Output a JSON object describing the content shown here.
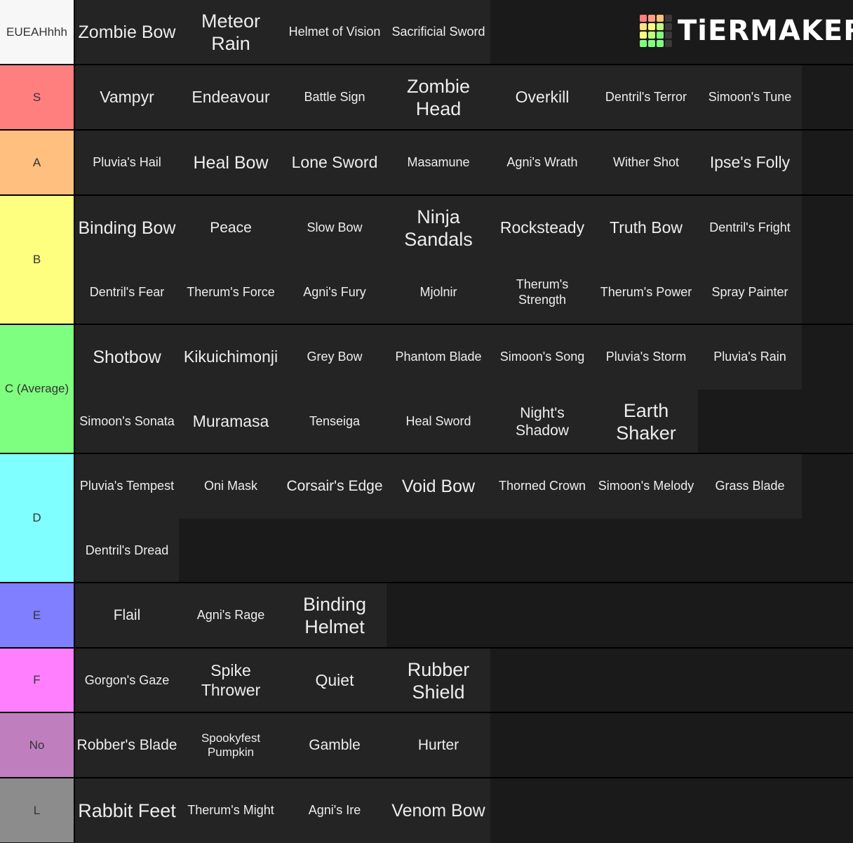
{
  "logo": {
    "text": "TiERMAKER",
    "grid_colors": [
      "#ff7f7f",
      "#ff9f7f",
      "#ffbf7f",
      "#3a3a3a",
      "#ffdf7f",
      "#ffff7f",
      "#bfff7f",
      "#3a3a3a",
      "#ffff7f",
      "#bfff7f",
      "#7fff7f",
      "#3a3a3a",
      "#7fff7f",
      "#7fff7f",
      "#7fff7f",
      "#3a3a3a"
    ]
  },
  "tiers": [
    {
      "label": "EUEAHhhh",
      "color": "#f7f7f7",
      "items": [
        "Zombie Bow",
        "Meteor Rain",
        "Helmet of Vision",
        "Sacrificial Sword"
      ]
    },
    {
      "label": "S",
      "color": "#ff7f7f",
      "items": [
        "Vampyr",
        "Endeavour",
        "Battle Sign",
        "Zombie Head",
        "Overkill",
        "Dentril's Terror",
        "Simoon's Tune"
      ]
    },
    {
      "label": "A",
      "color": "#ffbf7f",
      "items": [
        "Pluvia's Hail",
        "Heal Bow",
        "Lone Sword",
        "Masamune",
        "Agni's Wrath",
        "Wither Shot",
        "Ipse's Folly"
      ]
    },
    {
      "label": "B",
      "color": "#ffff7f",
      "items": [
        "Binding Bow",
        "Peace",
        "Slow Bow",
        "Ninja Sandals",
        "Rocksteady",
        "Truth Bow",
        "Dentril's Fright",
        "Dentril's Fear",
        "Therum's Force",
        "Agni's Fury",
        "Mjolnir",
        "Therum's Strength",
        "Therum's Power",
        "Spray Painter"
      ]
    },
    {
      "label": "C (Average)",
      "color": "#7fff7f",
      "items": [
        "Shotbow",
        "Kikuichimonji",
        "Grey Bow",
        "Phantom Blade",
        "Simoon's Song",
        "Pluvia's Storm",
        "Pluvia's Rain",
        "Simoon's Sonata",
        "Muramasa",
        "Tenseiga",
        "Heal Sword",
        "Night's Shadow",
        "Earth Shaker"
      ]
    },
    {
      "label": "D",
      "color": "#7fffff",
      "items": [
        "Pluvia's Tempest",
        "Oni Mask",
        "Corsair's Edge",
        "Void Bow",
        "Thorned Crown",
        "Simoon's Melody",
        "Grass Blade",
        "Dentril's Dread"
      ]
    },
    {
      "label": "E",
      "color": "#7f7fff",
      "items": [
        "Flail",
        "Agni's Rage",
        "Binding Helmet"
      ]
    },
    {
      "label": "F",
      "color": "#ff7fff",
      "items": [
        "Gorgon's Gaze",
        "Spike Thrower",
        "Quiet",
        "Rubber Shield"
      ]
    },
    {
      "label": "No",
      "color": "#bf7fbf",
      "items": [
        "Robber's Blade",
        "Spookyfest Pumpkin",
        "Gamble",
        "Hurter"
      ]
    },
    {
      "label": "L",
      "color": "#8c8c8c",
      "items": [
        "Rabbit Feet",
        "Therum's Might",
        "Agni's Ire",
        "Venom Bow"
      ]
    }
  ]
}
